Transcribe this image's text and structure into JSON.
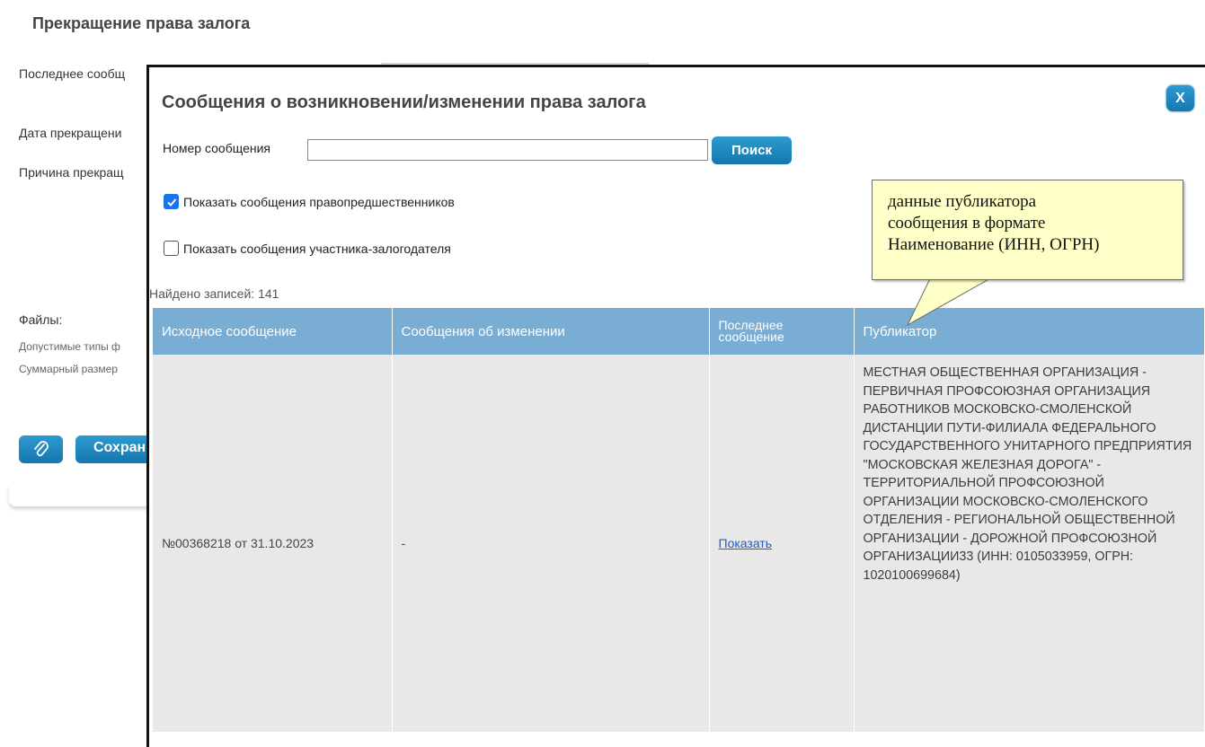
{
  "page": {
    "title": "Прекращение права залога",
    "last_message_label": "Последнее сообщ",
    "date_label": "Дата прекращени",
    "reason_label": "Причина прекращ",
    "files_label": "Файлы:",
    "allowed_types_label": "Допустимые типы ф",
    "total_size_label": "Суммарный размер",
    "save_label": "Сохранить"
  },
  "modal": {
    "title": "Сообщения о возникновении/изменении права залога",
    "close_label": "X",
    "search_label": "Номер сообщения",
    "search_value": "",
    "search_button": "Поиск",
    "checkbox_predecessors": {
      "label": "Показать сообщения правопредшественников",
      "checked": true
    },
    "checkbox_pledgor": {
      "label": "Показать сообщения участника-залогодателя",
      "checked": false
    },
    "found_text": "Найдено записей: 141",
    "table": {
      "columns": [
        "Исходное сообщение",
        "Сообщения об изменении",
        "Последнее сообщение",
        "Публикатор"
      ],
      "rows": [
        {
          "source": "№00368218 от 31.10.2023",
          "changes": "-",
          "last": "Показать",
          "publisher": "МЕСТНАЯ ОБЩЕСТВЕННАЯ ОРГАНИЗАЦИЯ - ПЕРВИЧНАЯ ПРОФСОЮЗНАЯ ОРГАНИЗАЦИЯ РАБОТНИКОВ МОСКОВСКО-СМОЛЕНСКОЙ ДИСТАНЦИИ ПУТИ-ФИЛИАЛА ФЕДЕРАЛЬНОГО ГОСУДАРСТВЕННОГО УНИТАРНОГО ПРЕДПРИЯТИЯ \"МОСКОВСКАЯ ЖЕЛЕЗНАЯ ДОРОГА\" - ТЕРРИТОРИАЛЬНОЙ ПРОФСОЮЗНОЙ ОРГАНИЗАЦИИ МОСКОВСКО-СМОЛЕНСКОГО ОТДЕЛЕНИЯ - РЕГИОНАЛЬНОЙ ОБЩЕСТВЕННОЙ ОРГАНИЗАЦИИ - ДОРОЖНОЙ ПРОФСОЮЗНОЙ ОРГАНИЗАЦИИ33 (ИНН: 0105033959, ОГРН: 1020100699684)"
        }
      ]
    }
  },
  "callout": {
    "lines": [
      "данные публикатора",
      "сообщения в формате",
      "Наименование (ИНН, ОГРН)"
    ]
  },
  "colors": {
    "accent_button": "#1f86bd",
    "table_header": "#7aadd3",
    "table_cell": "#e8e8e8",
    "callout_bg": "#ffffc8",
    "link": "#1a5ecb"
  }
}
